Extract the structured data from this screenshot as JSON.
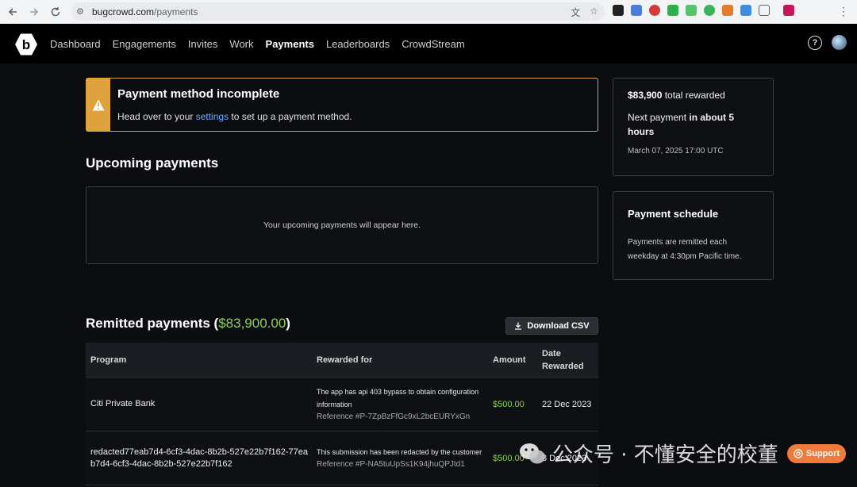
{
  "browser": {
    "url_host": "bugcrowd.com",
    "url_path": "/payments",
    "back_icon": "arrow-left-icon",
    "forward_icon": "arrow-right-icon",
    "reload_icon": "reload-icon"
  },
  "appbar": {
    "nav": [
      {
        "label": "Dashboard",
        "active": false
      },
      {
        "label": "Engagements",
        "active": false
      },
      {
        "label": "Invites",
        "active": false
      },
      {
        "label": "Work",
        "active": false
      },
      {
        "label": "Payments",
        "active": true
      },
      {
        "label": "Leaderboards",
        "active": false
      },
      {
        "label": "CrowdStream",
        "active": false
      }
    ],
    "help_glyph": "?"
  },
  "alert": {
    "title": "Payment method incomplete",
    "text_before": "Head over to your ",
    "link": "settings",
    "text_after": " to set up a payment method.",
    "icon": "warning-icon"
  },
  "upcoming": {
    "title": "Upcoming payments",
    "empty_text": "Your upcoming payments will appear here."
  },
  "remitted": {
    "title_prefix": "Remitted payments (",
    "amount": "$83,900.00",
    "title_suffix": ")",
    "download_label": "Download CSV",
    "columns": [
      "Program",
      "Rewarded for",
      "Amount",
      "Date Rewarded"
    ],
    "rows": [
      {
        "program": "Citi Private Bank",
        "desc": "The app has api 403 bypass to obtain configuration information",
        "ref": "Reference #P-7ZpBzFfGc9xL2bcEURYxGn",
        "amount": "$500.00",
        "date": "22 Dec 2023"
      },
      {
        "program": "redacted77eab7d4-6cf3-4dac-8b2b-527e22b7f162-77eab7d4-6cf3-4dac-8b2b-527e22b7f162",
        "desc": "This submission has been redacted by the customer",
        "ref": "Reference #P-NA5tuUpSs1K94jhuQPJtd1",
        "amount": "$500.00",
        "date": "8 Dec 2023"
      }
    ]
  },
  "summary": {
    "total": "$83,900",
    "total_suffix": " total rewarded",
    "next_prefix": "Next payment ",
    "next_bold": "in about 5 hours",
    "next_date": "March 07, 2025 17:00 UTC"
  },
  "schedule": {
    "title": "Payment schedule",
    "text": "Payments are remitted each weekday at 4:30pm Pacific time."
  },
  "watermark": {
    "text": "公众号 · 不懂安全的校董"
  },
  "support": {
    "label": "Support"
  },
  "colors": {
    "accent_warning": "#e0a23c",
    "amount_green": "#8fce5a",
    "link_blue": "#6ea8ff",
    "support_orange": "#f07a3c"
  }
}
